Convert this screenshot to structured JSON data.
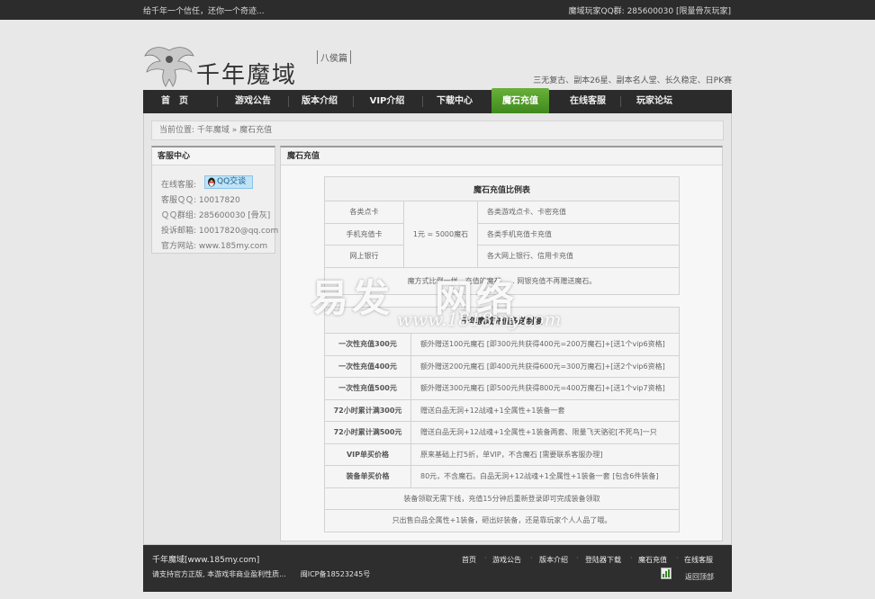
{
  "topbar": {
    "left": "给千年一个信任，还你一个奇迹...",
    "right": "魔域玩家QQ群: 285600030 [限量骨灰玩家]"
  },
  "logo": {
    "title": "千年魔域",
    "subtitle": "八侯篇"
  },
  "slogan": "三无复古、副本26星、副本名人堂、长久稳定、日PK赛",
  "nav": {
    "items": [
      "首　页",
      "游戏公告",
      "版本介绍",
      "VIP介绍",
      "下载中心",
      "魔石充值",
      "在线客服",
      "玩家论坛"
    ],
    "active_index": 5
  },
  "breadcrumb": "当前位置: 千年魔域 » 魔石充值",
  "service": {
    "title": "客服中心",
    "online_label": "在线客服:",
    "qq_button": "QQ交谈",
    "qq": "客服ＱＱ: 10017820",
    "group": "ＱＱ群组: 285600030 [骨灰]",
    "email": "投诉邮箱: 10017820@qq.com",
    "website": "官方网站: www.185my.com"
  },
  "main": {
    "title": "魔石充值",
    "ratio_table": {
      "title": "魔石充值比例表",
      "rate": "1元 = 5000魔石",
      "rows": [
        {
          "method": "各类点卡",
          "desc": "各类游戏点卡、卡密充值"
        },
        {
          "method": "手机充值卡",
          "desc": "各类手机充值卡充值"
        },
        {
          "method": "网上银行",
          "desc": "各大网上银行、信用卡充值"
        }
      ],
      "note": "魔方式比例一样，充值的魔石 . . . 网银充值不再赠送魔石。"
    },
    "bonus_table": {
      "title": "千年魔域充值多送制度",
      "rows": [
        {
          "key": "一次性充值300元",
          "value": "额外赠送100元魔石 [即300元共获得400元=200万魔石]+[送1个vip6资格]"
        },
        {
          "key": "一次性充值400元",
          "value": "额外赠送200元魔石 [即400元共获得600元=300万魔石]+[送2个vip6资格]"
        },
        {
          "key": "一次性充值500元",
          "value": "额外赠送300元魔石 [即500元共获得800元=400万魔石]+[送1个vip7资格]"
        },
        {
          "key": "72小时累计满300元",
          "value": "赠送白品无洞+12战魂+1全属性+1装备一套"
        },
        {
          "key": "72小时累计满500元",
          "value": "赠送白品无洞+12战魂+1全属性+1装备两套、限量飞天骆驼[不死鸟]一只"
        },
        {
          "key": "VIP单买价格",
          "value": "原来基础上打5折，单VIP，不含魔石 [需要联系客服办理]"
        },
        {
          "key": "装备单买价格",
          "value": "80元，不含魔石。白品无洞+12战魂+1全属性+1装备一套 [包含6件装备]"
        }
      ],
      "note1": "装备领取无需下线，充值15分钟后重新登录即可完成装备领取",
      "note2": "只出售白品全属性+1装备，砸出好装备，还是靠玩家个人人品了哦。"
    }
  },
  "footer": {
    "name": "千年魔域[www.185my.com]",
    "note": "请支持官方正版, 本游戏非商业盈利性质...　　闽ICP备18523245号",
    "links": [
      "首页",
      "游戏公告",
      "版本介绍",
      "登陆器下载",
      "魔石充值",
      "在线客服"
    ],
    "back": "返回顶部"
  },
  "watermark": {
    "text": "易发　网络",
    "url": "www.1818my.com"
  }
}
